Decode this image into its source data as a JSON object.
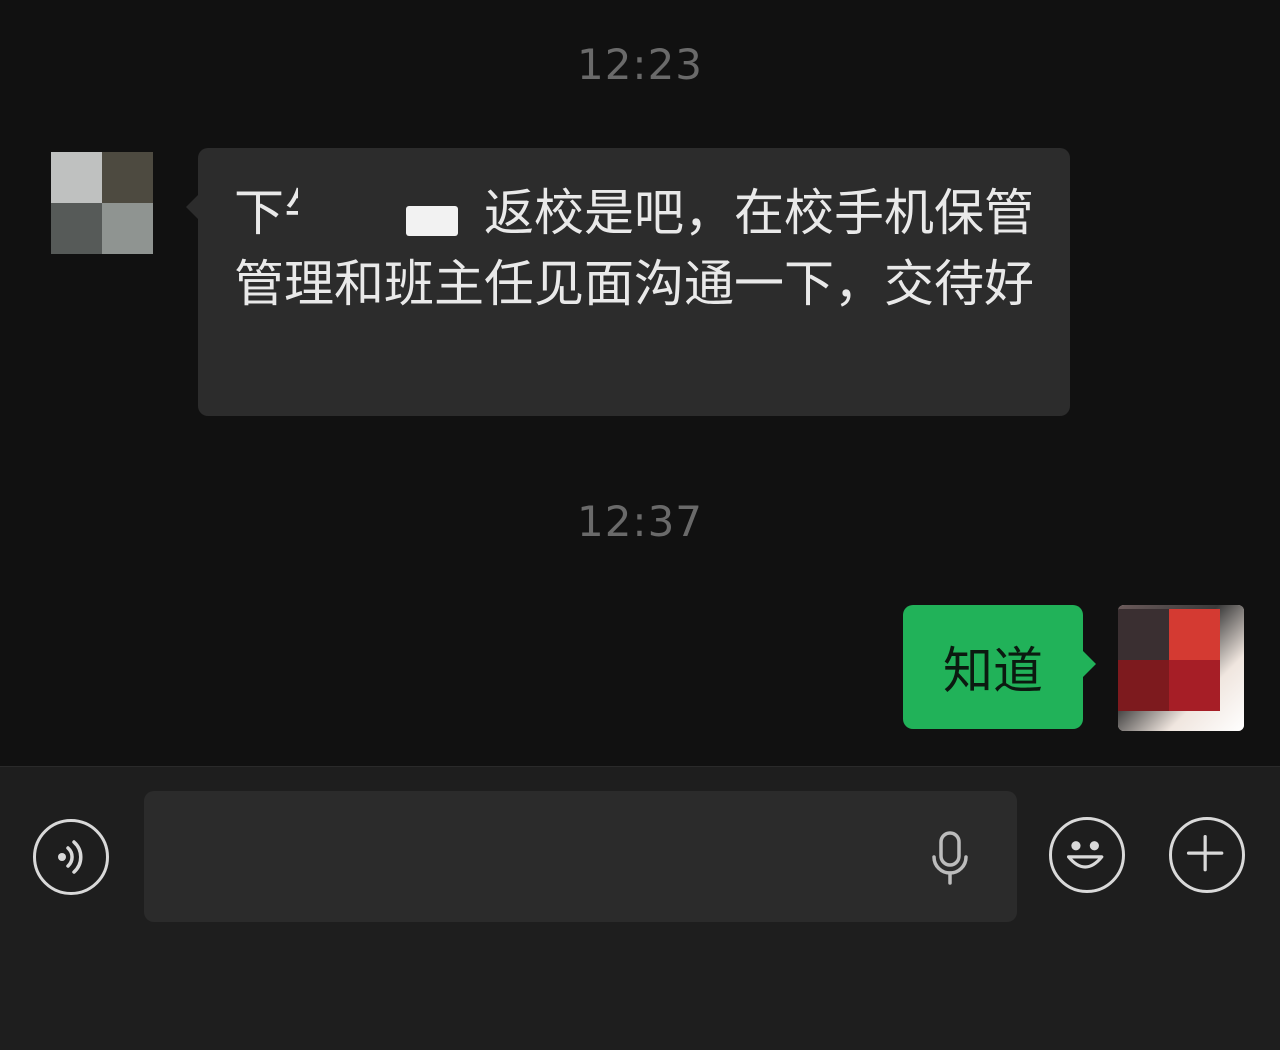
{
  "chat": {
    "timestamps": [
      "12:23",
      "12:37"
    ],
    "messages": [
      {
        "direction": "incoming",
        "text": "下午　　　返校是吧，在校手机保管管理和班主任见面沟通一下，交待好"
      },
      {
        "direction": "outgoing",
        "text": "知道"
      }
    ]
  },
  "input_bar": {
    "voice_icon": "voice-toggle-icon",
    "mic_icon": "microphone-icon",
    "emoji_icon": "emoji-icon",
    "plus_icon": "plus-icon",
    "input_value": ""
  },
  "colors": {
    "background": "#111111",
    "incoming_bubble": "#2c2c2c",
    "outgoing_bubble": "#21b259",
    "input_bar": "#1e1e1e"
  }
}
